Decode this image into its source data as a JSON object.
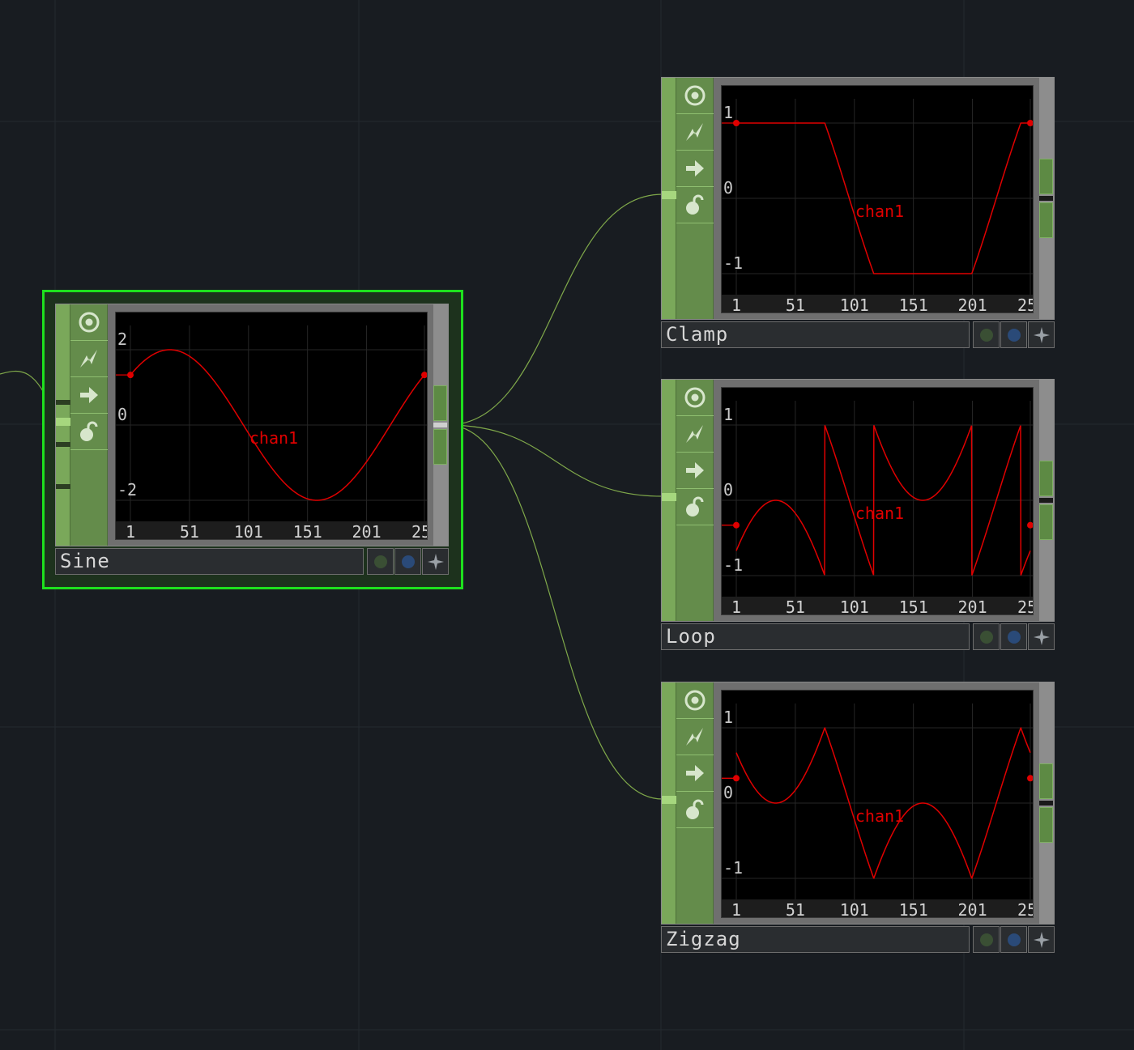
{
  "colors": {
    "background": "#181c21",
    "grid_line": "#242a30",
    "wire": "#7fa84a",
    "selection": "#1ee01e",
    "flag_strip": "#648c4b",
    "curve": "#e00000",
    "viewer_bg": "#000000",
    "display_dot": "#3a4f34",
    "render_dot": "#2a4a78",
    "bypass_icon": "#9aa0a6"
  },
  "icons": {
    "viewer_toggle": "viewer-active-icon",
    "cook": "lightning-icon",
    "export": "export-arrow-icon",
    "lock": "lock-icon",
    "display_flag": "display-flag-icon",
    "render_flag": "render-flag-icon",
    "bypass": "bypass-star-icon"
  },
  "nodes": [
    {
      "id": "sine",
      "name": "Sine",
      "selected": true,
      "y_ticks": [
        "2",
        "0",
        "-2"
      ],
      "x_ticks": [
        "1",
        "51",
        "101",
        "151",
        "201",
        "25"
      ],
      "channel_label": "chan1",
      "chart_data": {
        "type": "line",
        "series": [
          {
            "name": "chan1"
          }
        ],
        "x_range": [
          1,
          250
        ],
        "y_range": [
          -2,
          2
        ],
        "waveform": "sine",
        "start_value": 1.33,
        "end_value": 1.33
      }
    },
    {
      "id": "clamp",
      "name": "Clamp",
      "selected": false,
      "y_ticks": [
        "1",
        "0",
        "-1"
      ],
      "x_ticks": [
        "1",
        "51",
        "101",
        "151",
        "201",
        "25"
      ],
      "channel_label": "chan1",
      "chart_data": {
        "type": "line",
        "series": [
          {
            "name": "chan1"
          }
        ],
        "x_range": [
          1,
          250
        ],
        "y_range": [
          -1,
          1
        ],
        "waveform": "clamp",
        "start_value": 1,
        "end_value": 1
      }
    },
    {
      "id": "loop",
      "name": "Loop",
      "selected": false,
      "y_ticks": [
        "1",
        "0",
        "-1"
      ],
      "x_ticks": [
        "1",
        "51",
        "101",
        "151",
        "201",
        "25"
      ],
      "channel_label": "chan1",
      "chart_data": {
        "type": "line",
        "series": [
          {
            "name": "chan1"
          }
        ],
        "x_range": [
          1,
          250
        ],
        "y_range": [
          -1,
          1
        ],
        "waveform": "loop",
        "start_value": -0.33,
        "end_value": -0.33
      }
    },
    {
      "id": "zigzag",
      "name": "Zigzag",
      "selected": false,
      "y_ticks": [
        "1",
        "0",
        "-1"
      ],
      "x_ticks": [
        "1",
        "51",
        "101",
        "151",
        "201",
        "25"
      ],
      "channel_label": "chan1",
      "chart_data": {
        "type": "line",
        "series": [
          {
            "name": "chan1"
          }
        ],
        "x_range": [
          1,
          250
        ],
        "y_range": [
          -1,
          1
        ],
        "waveform": "zigzag",
        "start_value": 0.33,
        "end_value": 0.33
      }
    }
  ]
}
